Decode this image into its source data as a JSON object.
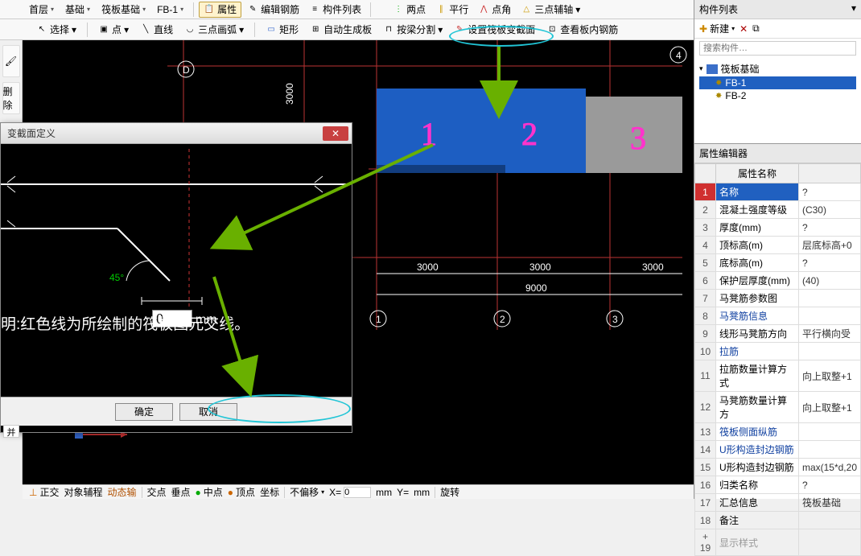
{
  "toolbar": {
    "dd1": "首层",
    "dd2": "基础",
    "dd3": "筏板基础",
    "dd4": "FB-1",
    "btn_attr": "属性",
    "btn_editRebar": "编辑钢筋",
    "btn_compList": "构件列表",
    "btn_twoPoint": "两点",
    "btn_parallel": "平行",
    "btn_pointAngle": "点角",
    "btn_threePointAux": "三点辅轴"
  },
  "toolbar2": {
    "select": "选择",
    "point": "点",
    "line": "直线",
    "arc3": "三点画弧",
    "rect": "矩形",
    "autoGen": "自动生成板",
    "splitBeam": "按梁分割",
    "setSection": "设置筏板变截面",
    "viewRebar": "查看板内钢筋"
  },
  "left": {
    "del": "删除",
    "merge": "并"
  },
  "right": {
    "title": "构件列表",
    "new": "新建",
    "searchPlaceholder": "搜索构件…",
    "treeRoot": "筏板基础",
    "treeItem1": "FB-1",
    "treeItem2": "FB-2",
    "propsTitle": "属性编辑器",
    "colName": "属性名称",
    "rows": [
      {
        "n": "1",
        "name": "名称",
        "val": "?",
        "sel": true
      },
      {
        "n": "2",
        "name": "混凝土强度等级",
        "val": "(C30)"
      },
      {
        "n": "3",
        "name": "厚度(mm)",
        "val": "?"
      },
      {
        "n": "4",
        "name": "顶标高(m)",
        "val": "层底标高+0"
      },
      {
        "n": "5",
        "name": "底标高(m)",
        "val": "?"
      },
      {
        "n": "6",
        "name": "保护层厚度(mm)",
        "val": "(40)"
      },
      {
        "n": "7",
        "name": "马凳筋参数图",
        "val": ""
      },
      {
        "n": "8",
        "name": "马凳筋信息",
        "val": "",
        "link": true
      },
      {
        "n": "9",
        "name": "线形马凳筋方向",
        "val": "平行横向受"
      },
      {
        "n": "10",
        "name": "拉筋",
        "val": "",
        "link": true
      },
      {
        "n": "11",
        "name": "拉筋数量计算方式",
        "val": "向上取整+1"
      },
      {
        "n": "12",
        "name": "马凳筋数量计算方",
        "val": "向上取整+1"
      },
      {
        "n": "13",
        "name": "筏板侧面纵筋",
        "val": "",
        "link": true
      },
      {
        "n": "14",
        "name": "U形构造封边钢筋",
        "val": "",
        "link": true
      },
      {
        "n": "15",
        "name": "U形构造封边钢筋",
        "val": "max(15*d,20"
      },
      {
        "n": "16",
        "name": "归类名称",
        "val": "?"
      },
      {
        "n": "17",
        "name": "汇总信息",
        "val": "筏板基础"
      },
      {
        "n": "18",
        "name": "备注",
        "val": ""
      },
      {
        "n": "19",
        "name": "显示样式",
        "val": "",
        "grey": true,
        "plus": true
      }
    ]
  },
  "canvas": {
    "dim3000a": "3000",
    "dim3000b": "3000",
    "dim3000c": "3000",
    "dim3000d": "3000",
    "dim9000": "9000",
    "ptD": "D",
    "pt1": "1",
    "pt2": "2",
    "pt3": "3",
    "pt4": "4",
    "pink1": "1",
    "pink2": "2",
    "pink3": "3"
  },
  "dialog": {
    "title": "变截面定义",
    "angle": "45°",
    "inputVal": "0",
    "unit": "mm",
    "note": "明:红色线为所绘制的筏板图元交线。",
    "ok": "确定",
    "cancel": "取消"
  },
  "status": {
    "s1": "正交",
    "s2": "对象辅程",
    "s3": "动态输",
    "s4": "交点",
    "s5": "垂点",
    "s6": "中点",
    "s7": "顶点",
    "s8": "坐标",
    "s9": "不偏移",
    "x": "X=",
    "xv": "0",
    "y": "Y=",
    "mm": "mm",
    "rot": "旋转"
  }
}
